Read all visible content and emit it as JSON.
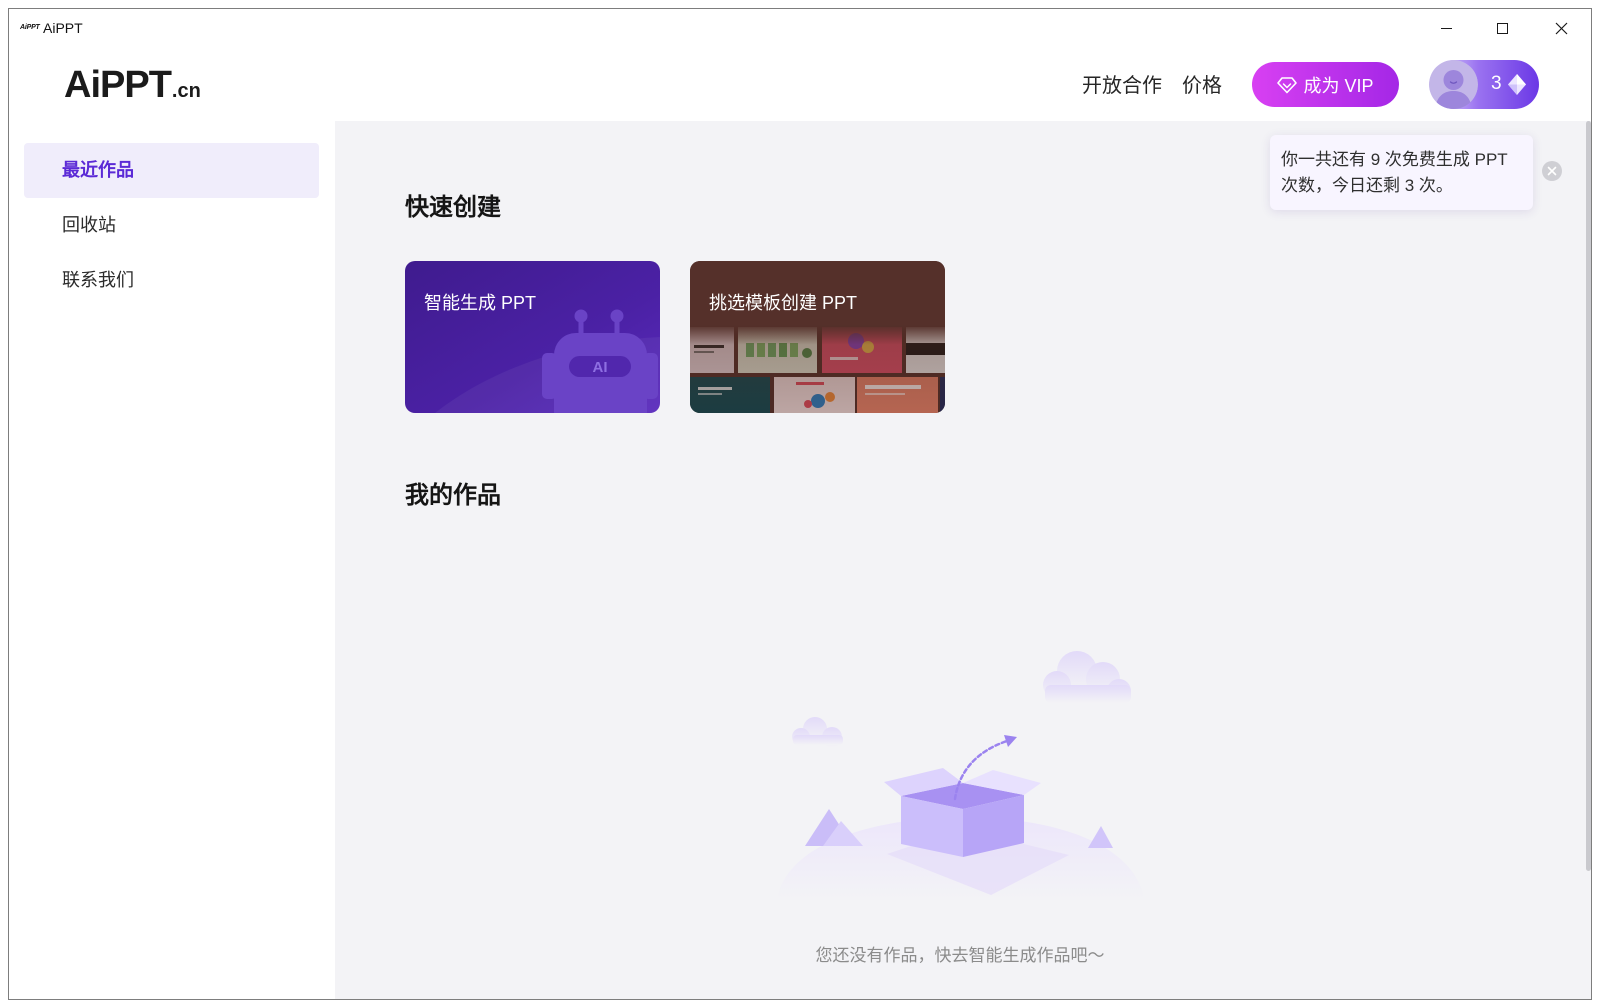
{
  "window": {
    "icon_text": "AiPPT",
    "title": "AiPPT",
    "controls": {
      "minimize": "minimize-icon",
      "maximize": "maximize-icon",
      "close": "close-icon"
    }
  },
  "header": {
    "logo": {
      "main": "AiPPT",
      "suffix": ".cn"
    },
    "nav": [
      {
        "label": "开放合作"
      },
      {
        "label": "价格"
      }
    ],
    "vip_button": {
      "label": "成为 VIP",
      "icon": "diamond-outline-icon"
    },
    "account": {
      "avatar": "user-avatar-icon",
      "gem_count": "3",
      "gem_icon": "diamond-gem-icon"
    }
  },
  "sidebar": {
    "active_index": 0,
    "items": [
      {
        "label": "最近作品"
      },
      {
        "label": "回收站"
      },
      {
        "label": "联系我们"
      }
    ]
  },
  "quick_create": {
    "title": "快速创建",
    "cards": [
      {
        "label": "智能生成 PPT",
        "badge": "AI",
        "illustration": "robot-icon"
      },
      {
        "label": "挑选模板创建 PPT",
        "illustration": "template-thumbnails"
      }
    ]
  },
  "my_works": {
    "title": "我的作品",
    "empty_text": "您还没有作品，快去智能生成作品吧～",
    "illustration": "empty-box-illustration"
  },
  "tooltip": {
    "lines": [
      "你一共还有 9 次免费生成 PPT",
      "次数，今日还剩 3 次。"
    ],
    "close_icon": "close-circle-icon"
  },
  "colors": {
    "accent": "#5b2ad6",
    "main_bg": "#f3f3f6",
    "sidebar_active_bg": "#f0edfb",
    "vip_gradient": [
      "#d840f2",
      "#a427e6"
    ]
  }
}
